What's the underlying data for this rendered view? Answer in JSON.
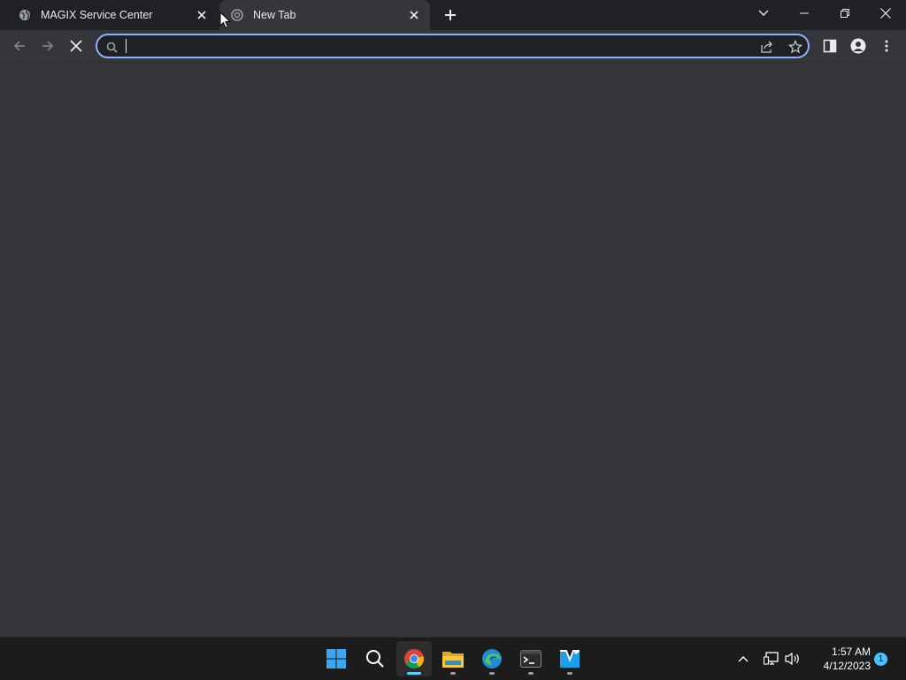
{
  "tabs": [
    {
      "title": "MAGIX Service Center",
      "icon": "globe-icon",
      "active": false
    },
    {
      "title": "New Tab",
      "icon": "chrome-newtab-icon",
      "active": true
    }
  ],
  "omnibox": {
    "value": "",
    "placeholder": ""
  },
  "clock": {
    "time": "1:57 AM",
    "date": "4/12/2023"
  },
  "notifications": {
    "count": "1"
  },
  "taskbar": {
    "apps": [
      "start-icon",
      "search-icon",
      "chrome-icon",
      "file-explorer-icon",
      "edge-icon",
      "terminal-icon",
      "editor-app-icon"
    ]
  },
  "colors": {
    "accent": "#8ab4f8",
    "taskbar_active": "#60cdff",
    "background": "#35363a"
  }
}
